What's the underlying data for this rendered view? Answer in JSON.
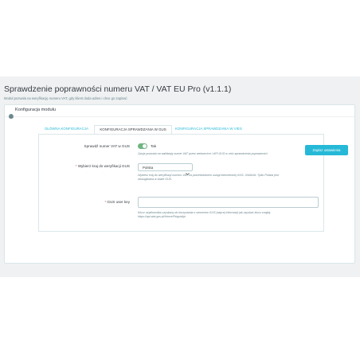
{
  "header": {
    "title": "Sprawdzenie poprawności numeru VAT / VAT EU Pro (v1.1.1)",
    "description": "Moduł pozwala na weryfikację numeru VAT, gdy klient doda adres i chce go zapisać"
  },
  "panel": {
    "heading": "Konfiguracja modułu",
    "heading_icon": "gear-icon"
  },
  "tabs": [
    {
      "label": "GŁÓWNA KONFIGURACJA",
      "active": false
    },
    {
      "label": "KONFIGURACJA SPRAWDZANIA W GUS",
      "active": true
    },
    {
      "label": "KONFIGURACJA SPRAWDZANIA W VIES",
      "active": false
    }
  ],
  "form": {
    "check_vat": {
      "label": "Sprawdź numer VAT w GUS",
      "state_label": "Tak",
      "enabled": true,
      "help": "Opcja pozwala na walidację numer VAT przez webservice / API GUS w celu sprawdzenia poprawności"
    },
    "country": {
      "label": "Wybierz kraj do weryfikacji GUS",
      "selected": "Polska",
      "help_line1": "Wybierz kraj do weryfikacji numeru VAT za pośrednictwem usługi internetowej GUS. UWAGA: Tylko Polska jest",
      "help_line2": "obsługiwana w bazie GUS."
    },
    "gus_key": {
      "label": "GUS user key",
      "value": "",
      "help_line1": "Klucz użytkownika uzyskany do korzystania z serwerów GUS (więcej informacji jak uzyskać klucz znajdą",
      "help_line2": "https://api.stat.gov.pl/Home/RegonApi"
    }
  },
  "actions": {
    "save_label": "Zapisz ustawienia"
  },
  "colors": {
    "accent": "#25b9d7",
    "switch_on": "#70b580",
    "required": "#c05c67"
  }
}
